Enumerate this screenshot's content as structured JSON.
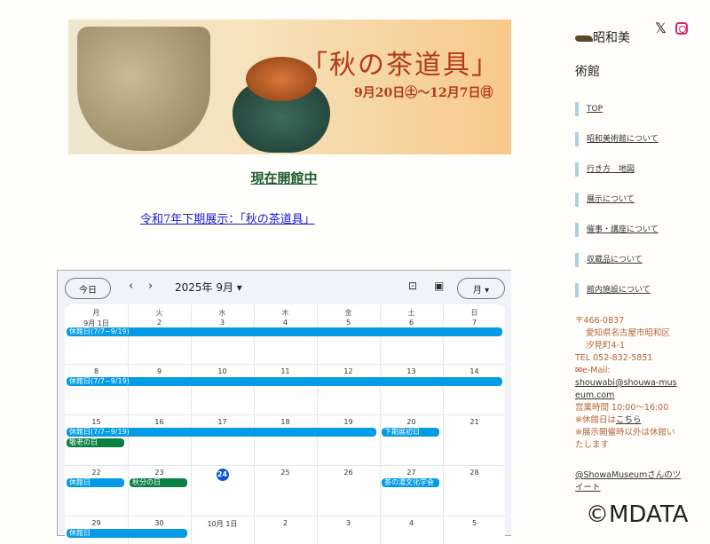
{
  "banner": {
    "title": "「秋の茶道具」",
    "dates": "9月20日㊏〜12月7日㊐"
  },
  "status": "現在開館中",
  "exhibition_link": "令和7年下期展示：「秋の茶道具」",
  "calendar": {
    "today_label": "今日",
    "prev": "‹",
    "next": "›",
    "month": "2025年 9月 ▾",
    "view": "月 ▾",
    "weekdays": [
      "月",
      "火",
      "水",
      "木",
      "金",
      "土",
      "日"
    ],
    "weeks": [
      [
        "9月 1日",
        "2",
        "3",
        "4",
        "5",
        "6",
        "7"
      ],
      [
        "8",
        "9",
        "10",
        "11",
        "12",
        "13",
        "14"
      ],
      [
        "15",
        "16",
        "17",
        "18",
        "19",
        "20",
        "21"
      ],
      [
        "22",
        "23",
        "24",
        "25",
        "26",
        "27",
        "28"
      ],
      [
        "29",
        "30",
        "10月 1日",
        "2",
        "3",
        "4",
        "5"
      ]
    ],
    "today": "24",
    "events": [
      {
        "week": 0,
        "col": 0,
        "span": 7,
        "lane": 0,
        "label": "休館日(7/7~9/19)",
        "color": "#039be5"
      },
      {
        "week": 1,
        "col": 0,
        "span": 7,
        "lane": 0,
        "label": "休館日(7/7~9/19)",
        "color": "#039be5"
      },
      {
        "week": 2,
        "col": 0,
        "span": 5,
        "lane": 0,
        "label": "休館日(7/7~9/19)",
        "color": "#039be5"
      },
      {
        "week": 2,
        "col": 5,
        "span": 1,
        "lane": 0,
        "label": "下期展初日",
        "color": "#039be5"
      },
      {
        "week": 2,
        "col": 0,
        "span": 1,
        "lane": 1,
        "label": "敬老の日",
        "color": "#0b8043"
      },
      {
        "week": 3,
        "col": 0,
        "span": 1,
        "lane": 0,
        "label": "休館日",
        "color": "#039be5"
      },
      {
        "week": 3,
        "col": 1,
        "span": 1,
        "lane": 0,
        "label": "秋分の日",
        "color": "#0b8043"
      },
      {
        "week": 3,
        "col": 5,
        "span": 1,
        "lane": 0,
        "label": "茶の湯文化学会",
        "color": "#039be5"
      },
      {
        "week": 4,
        "col": 0,
        "span": 2,
        "lane": 0,
        "label": "休館日",
        "color": "#039be5"
      }
    ]
  },
  "sidebar": {
    "logo": "昭和美術館",
    "x": "𝕏",
    "nav": [
      "TOP",
      "昭和美術館について",
      "行き方　地図",
      "展示について",
      "催事・講座について",
      "収蔵品について",
      "館内施設について"
    ],
    "postal": "〒466-0837",
    "addr1": "愛知県名古屋市昭和区",
    "addr2": "汐見町4-1",
    "tel": "TEL 052-832-5851",
    "email_label": "e-Mail:",
    "email": "shouwabi@shouwa-museum.com",
    "hours": "営業時間 10:00〜16:00",
    "closed_prefix": "※休館日は",
    "closed_link": "こちら",
    "note": "※展示開催時以外は休館いたします",
    "tweets": "@ShowaMuseumさんのツイート"
  },
  "watermark": "©MDATA"
}
